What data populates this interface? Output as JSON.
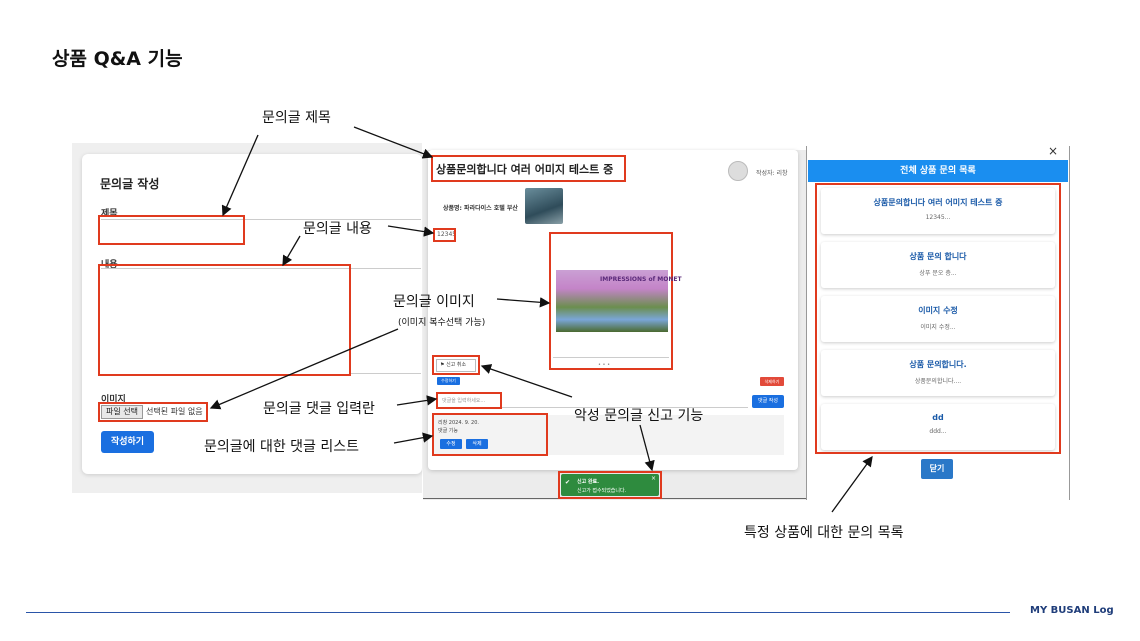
{
  "slide": {
    "title": "상품 Q&A 기능",
    "footer": "MY BUSAN Log"
  },
  "form": {
    "title": "문의글 작성",
    "subject_label": "제목",
    "content_label": "내용",
    "image_label": "이미지",
    "file_button": "파일 선택",
    "file_none": "선택된 파일 없음",
    "submit": "작성하기"
  },
  "detail": {
    "title": "상품문의합니다 여러 어미지 테스트 중",
    "writer": "작성자: 리창",
    "product": "상품명: 파라다이스 호텔 부산",
    "content": "12345",
    "monet_text": "IMPRESSIONS of MONET",
    "report_button": "신고 취소",
    "edit_button": "수정하기",
    "delete_button": "삭제하기",
    "comment_placeholder": "댓글을 입력하세요...",
    "comment_submit": "댓글 작성",
    "comment_author": "리창 2024. 9. 20.",
    "comment_text": "댓글 기능",
    "comment_edit": "수정",
    "comment_delete": "삭제",
    "toast_title": "신고 완료.",
    "toast_sub": "신고가 접수되었습니다."
  },
  "list": {
    "header": "전체 상품 문의 목록",
    "close_x": "×",
    "close_button": "닫기",
    "items": [
      {
        "title": "상품문의합니다 여러 어미지 테스트 중",
        "preview": "12345..."
      },
      {
        "title": "상품 문의 합니다",
        "preview": "상푸 문오 층..."
      },
      {
        "title": "이미지 수정",
        "preview": "이미지 수정..."
      },
      {
        "title": "상품 문의합니다.",
        "preview": "상품문의합니다...."
      },
      {
        "title": "dd",
        "preview": "ddd..."
      }
    ]
  },
  "annotations": {
    "title": "문의글 제목",
    "content": "문의글 내용",
    "image": "문의글 이미지",
    "image_sub": "(이미지 복수선택 가능)",
    "comment_input": "문의글 댓글 입력란",
    "comment_list": "문의글에 대한 댓글 리스트",
    "report": "악성 문의글 신고 기능",
    "inquiry_list": "특정 상품에 대한 문의 목록"
  },
  "colors": {
    "highlight": "#e03a1e",
    "primary": "#1a6fe0",
    "footer_line": "#2a55a8"
  }
}
